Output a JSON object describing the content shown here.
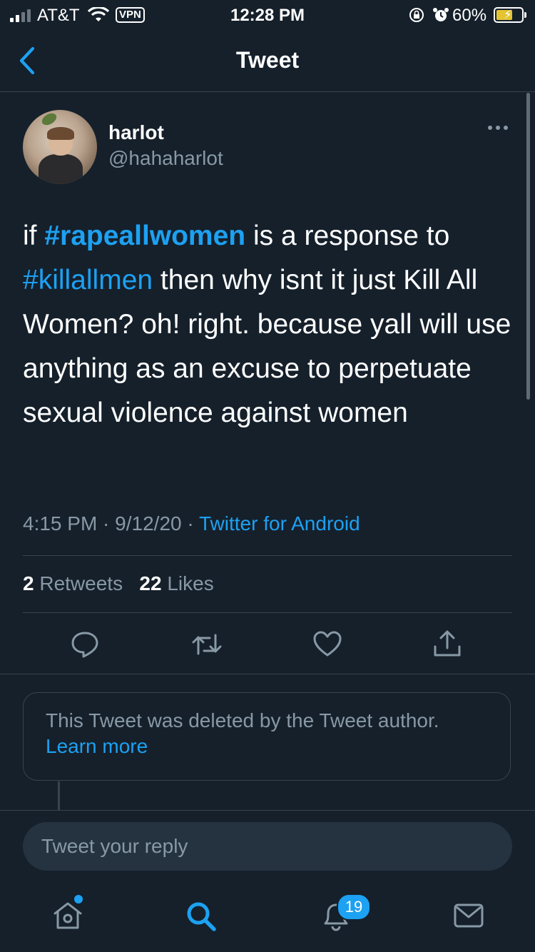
{
  "status_bar": {
    "carrier": "AT&T",
    "vpn": "VPN",
    "time": "12:28 PM",
    "battery": "60%",
    "battery_level": 0.6,
    "battery_color": "#e4c433"
  },
  "nav": {
    "title": "Tweet",
    "back_icon": "chevron-left-icon"
  },
  "tweet": {
    "display_name": "harlot",
    "handle": "@hahaharlot",
    "text_parts": {
      "p1": "if ",
      "tag1": "#rapeallwomen",
      "p2": " is a response to ",
      "tag2": "#killallmen",
      "p3": " then why isnt it just Kill All Women? oh! right. because yall will use anything as an excuse to perpetuate sexual violence against women"
    },
    "time": "4:15 PM",
    "sep1": " · ",
    "date": "9/12/20",
    "sep2": " · ",
    "source": "Twitter for Android",
    "retweets_count": "2",
    "retweets_label": "Retweets",
    "likes_count": "22",
    "likes_label": "Likes"
  },
  "actions": [
    "reply-icon",
    "retweet-icon",
    "like-icon",
    "share-icon"
  ],
  "deleted_notice": {
    "text": "This Tweet was deleted by the Tweet author.",
    "link": "Learn more"
  },
  "reply": {
    "placeholder": "Tweet your reply"
  },
  "tab_bar": {
    "notifications_badge": "19",
    "tabs": [
      "home-icon",
      "search-icon",
      "notifications-icon",
      "messages-icon"
    ]
  },
  "colors": {
    "background": "#15202b",
    "accent": "#1da1f2",
    "secondary_text": "#8899a6",
    "divider": "#38444d"
  }
}
